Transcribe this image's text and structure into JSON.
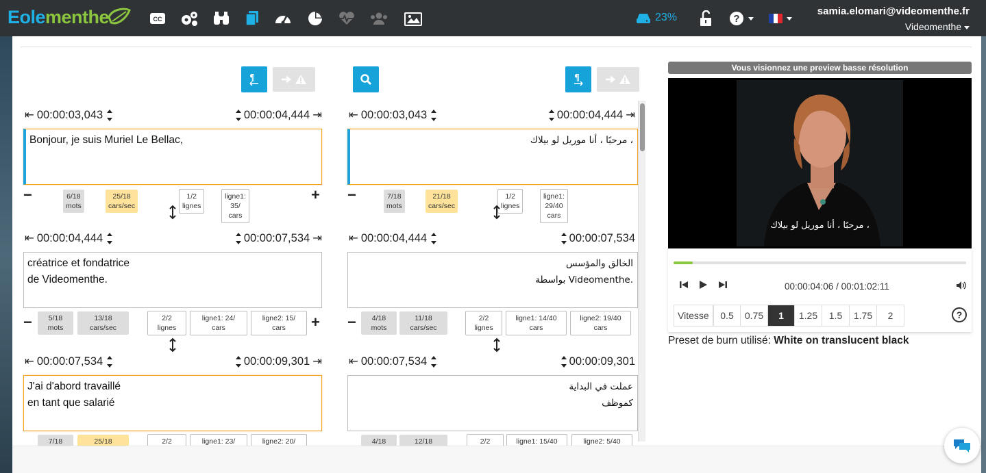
{
  "header": {
    "logo_part1": "Eole",
    "logo_part2": "menthe",
    "cpu_percent": "23%",
    "user_email": "samia.elomari@videomenthe.fr",
    "organization": "Videomenthe",
    "nav_icons": [
      "cc-icon",
      "settings-icon",
      "binoculars-icon",
      "files-icon",
      "dashboard-icon",
      "pie-chart-icon",
      "heartbeat-icon",
      "users-icon",
      "image-icon"
    ]
  },
  "left_column": {
    "subtitles": [
      {
        "start": "00:00:03,043",
        "end": "00:00:04,444",
        "lines": [
          "Bonjour, je suis Muriel Le Bellac,"
        ],
        "stats": {
          "words": "6/18 mots",
          "cps": "25/18 cars/sec",
          "lines": "1/2 lignes",
          "line1": "ligne1: 35/ cars"
        }
      },
      {
        "start": "00:00:04,444",
        "end": "00:00:07,534",
        "lines": [
          "créatrice et fondatrice",
          "de Videomenthe."
        ],
        "stats": {
          "words_a": "5/18",
          "words_b": "mots",
          "cps_a": "13/18",
          "cps_b": "cars/sec",
          "lines_a": "2/2",
          "lines_b": "lignes",
          "line1_a": "ligne1: 24/",
          "line1_b": "cars",
          "line2_a": "ligne2: 15/",
          "line2_b": "cars"
        }
      },
      {
        "start": "00:00:07,534",
        "end": "00:00:09,301",
        "lines": [
          "J'ai d'abord travaillé",
          "en tant que salarié"
        ],
        "stats": {
          "words_a": "7/18",
          "cps_a": "25/18",
          "lines_a": "2/2",
          "line1_a": "ligne1: 23/",
          "line2_a": "ligne2: 20/"
        }
      }
    ]
  },
  "right_column": {
    "subtitles": [
      {
        "start": "00:00:03,043",
        "end": "00:00:04,444",
        "lines": [
          "، مرحبًا ، أنا موريل لو بيلاك"
        ],
        "stats": {
          "words": "7/18 mots",
          "cps": "21/18 cars/sec",
          "lines": "1/2 lignes",
          "line1": "ligne1: 29/40 cars"
        }
      },
      {
        "start": "00:00:04,444",
        "end": "00:00:07,534",
        "lines": [
          "الخالق والمؤسس",
          ".Videomenthe بواسطة"
        ],
        "stats": {
          "words_a": "4/18",
          "words_b": "mots",
          "cps_a": "11/18",
          "cps_b": "cars/sec",
          "lines_a": "2/2",
          "lines_b": "lignes",
          "line1_a": "ligne1: 14/40",
          "line1_b": "cars",
          "line2_a": "ligne2: 19/40",
          "line2_b": "cars"
        }
      },
      {
        "start": "00:00:07,534",
        "end": "00:00:09,301",
        "lines": [
          "عملت في البداية",
          "كموظف"
        ],
        "stats": {
          "words_a": "4/18",
          "cps_a": "12/18",
          "lines_a": "2/2",
          "line1_a": "ligne1: 15/40",
          "line2_a": "ligne2: 5/40"
        }
      }
    ]
  },
  "preview": {
    "banner": "Vous visionnez une preview basse résolution",
    "overlay_subtitle": "، مرحبًا ، أنا موريل لو بيلاك",
    "time": "00:00:04:06 / 00:01:02:11",
    "progress": 0.065,
    "speed_label": "Vitesse",
    "speeds": [
      "0.5",
      "0.75",
      "1",
      "1.25",
      "1.5",
      "1.75",
      "2"
    ],
    "selected_speed": "1",
    "preset_label": "Preset de burn utilisé:",
    "preset_value": "White on translucent black"
  },
  "colors": {
    "accent": "#16a3d9",
    "brand_green": "#8cc63f",
    "active_border": "#f3a428",
    "warn_badge": "#ffe39a"
  }
}
